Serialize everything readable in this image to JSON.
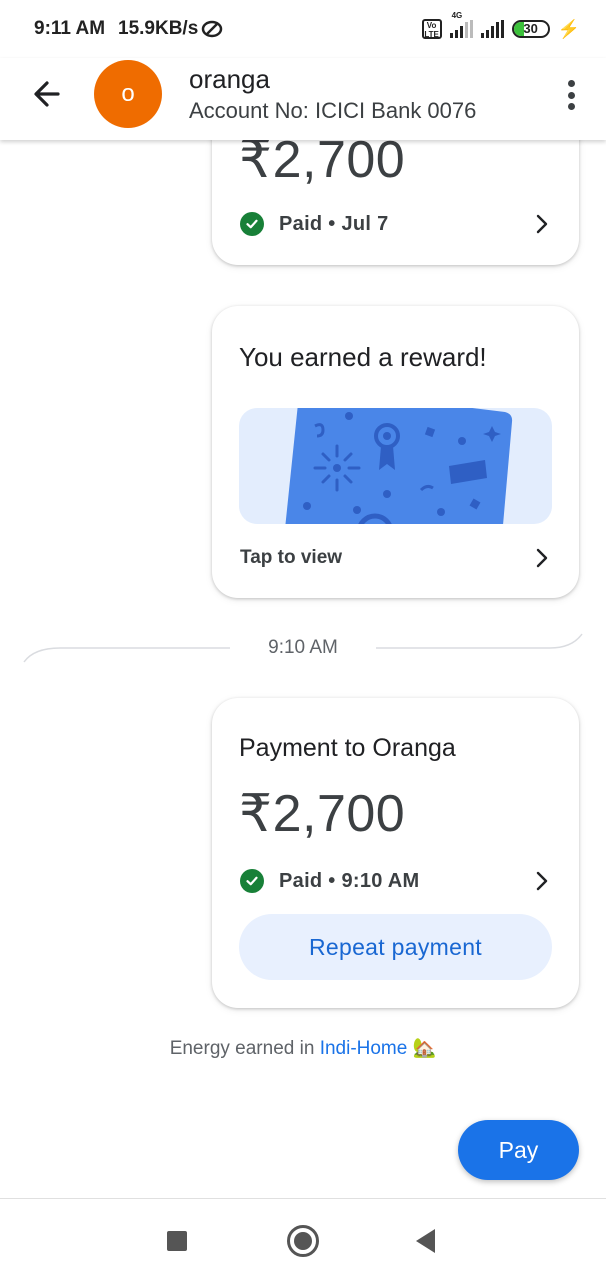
{
  "status_bar": {
    "time": "9:11 AM",
    "speed": "15.9KB/s",
    "network_type": "4G",
    "volte": "Vo LTE",
    "battery": "30",
    "battery_level": 0.3
  },
  "header": {
    "avatar_initial": "o",
    "name": "oranga",
    "account": "Account No: ICICI Bank 0076"
  },
  "colors": {
    "avatar": "#ef6c00",
    "accent": "#1a73e8",
    "paid_green": "#188038"
  },
  "transactions": [
    {
      "amount": "₹2,700",
      "status": "Paid • Jul 7"
    }
  ],
  "reward": {
    "title": "You earned a reward!",
    "cta": "Tap to view"
  },
  "divider_time": "9:10 AM",
  "payment": {
    "title": "Payment to Oranga",
    "amount": "₹2,700",
    "status": "Paid • 9:10 AM",
    "repeat_label": "Repeat payment"
  },
  "energy": {
    "prefix": "Energy earned in ",
    "link": "Indi-Home",
    "emoji": "🏡"
  },
  "pay_button": "Pay"
}
